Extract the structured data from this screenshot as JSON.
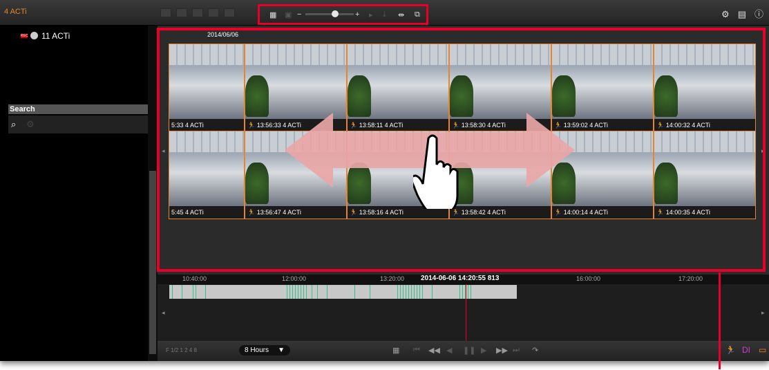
{
  "window": {
    "title": "4 ACTi"
  },
  "device": {
    "name": "11 ACTi",
    "rec": "REC"
  },
  "search": {
    "label": "Search"
  },
  "main": {
    "date": "2014/06/06"
  },
  "thumbnails": [
    {
      "caption": "5:33  4 ACTi",
      "motion": false
    },
    {
      "caption": "13:56:33  4 ACTi",
      "motion": true
    },
    {
      "caption": "13:58:11  4 ACTi",
      "motion": true
    },
    {
      "caption": "13:58:30  4 ACTi",
      "motion": true
    },
    {
      "caption": "13:59:02  4 ACTi",
      "motion": true
    },
    {
      "caption": "14:00:32  4 ACTi",
      "motion": true
    },
    {
      "caption": "5:45  4 ACTi",
      "motion": false
    },
    {
      "caption": "13:56:47  4 ACTi",
      "motion": true
    },
    {
      "caption": "13:58:16  4 ACTi",
      "motion": true
    },
    {
      "caption": "13:58:42  4 ACTi",
      "motion": true
    },
    {
      "caption": "14:00:14  4 ACTi",
      "motion": true
    },
    {
      "caption": "14:00:35  4 ACTi",
      "motion": true
    }
  ],
  "timeline": {
    "ticks": [
      "10:40:00",
      "12:00:00",
      "13:20:00",
      "16:00:00",
      "17:20:00"
    ],
    "current": "2014-06-06 14:20:55 813"
  },
  "bottom": {
    "rates": "F   1/2   1   2   4   8",
    "hours": "8 Hours",
    "di": "DI"
  },
  "colors": {
    "accent": "#e8852c",
    "highlight": "#e8002a",
    "motion": "#2fc38a"
  }
}
